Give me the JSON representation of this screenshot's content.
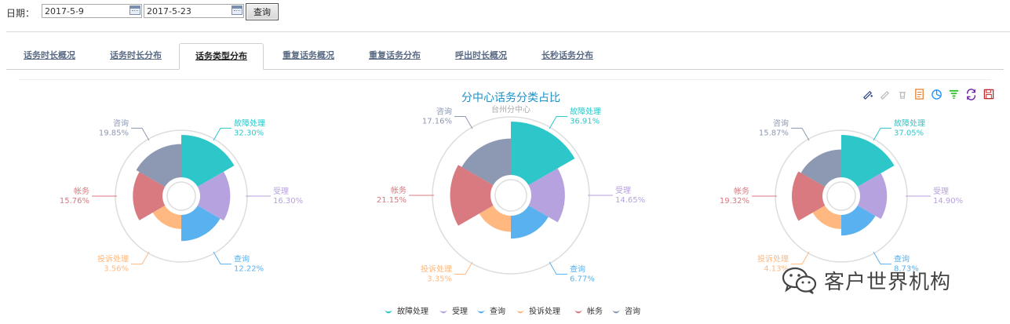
{
  "filter": {
    "date_label": "日期：",
    "start_date": "2017-5-9",
    "end_date": "2017-5-23",
    "query_label": "查询"
  },
  "tabs": [
    {
      "label": "话务时长概况",
      "active": false
    },
    {
      "label": "话务时长分布",
      "active": false
    },
    {
      "label": "话务类型分布",
      "active": true
    },
    {
      "label": "重复话务概况",
      "active": false
    },
    {
      "label": "重复话务分布",
      "active": false
    },
    {
      "label": "呼出时长概况",
      "active": false
    },
    {
      "label": "长秒话务分布",
      "active": false
    }
  ],
  "toolbox": [
    "mark-icon",
    "mark-undo-icon",
    "mark-clear-icon",
    "data-view-icon",
    "pie-switch-icon",
    "funnel-switch-icon",
    "restore-icon",
    "save-image-icon"
  ],
  "colors": {
    "故障处理": "#2ec7c9",
    "受理": "#b6a2de",
    "查询": "#5ab1ef",
    "投诉处理": "#ffb980",
    "帐务": "#d87a80",
    "咨询": "#8d98b3"
  },
  "chart_data": [
    {
      "type": "pie",
      "subtype": "rose",
      "title": "",
      "subtitle": "",
      "categories": [
        "故障处理",
        "受理",
        "查询",
        "投诉处理",
        "帐务",
        "咨询"
      ],
      "values": [
        32.3,
        16.3,
        12.22,
        3.56,
        15.76,
        19.85
      ],
      "labels": [
        "32.30%",
        "16.30%",
        "12.22%",
        "3.56%",
        "15.76%",
        "19.85%"
      ]
    },
    {
      "type": "pie",
      "subtype": "rose",
      "title": "分中心话务分类占比",
      "subtitle": "台州分中心",
      "categories": [
        "故障处理",
        "受理",
        "查询",
        "投诉处理",
        "帐务",
        "咨询"
      ],
      "values": [
        36.91,
        14.65,
        6.77,
        3.35,
        21.15,
        17.16
      ],
      "labels": [
        "36.91%",
        "14.65%",
        "6.77%",
        "3.35%",
        "21.15%",
        "17.16%"
      ]
    },
    {
      "type": "pie",
      "subtype": "rose",
      "title": "",
      "subtitle": "",
      "categories": [
        "故障处理",
        "受理",
        "查询",
        "投诉处理",
        "帐务",
        "咨询"
      ],
      "values": [
        37.05,
        14.9,
        8.73,
        4.13,
        19.32,
        15.87
      ],
      "labels": [
        "37.05%",
        "14.90%",
        "8.73%",
        "4.13%",
        "19.32%",
        "15.87%"
      ]
    }
  ],
  "legend": {
    "position": "bottom-center",
    "items": [
      "故障处理",
      "受理",
      "查询",
      "投诉处理",
      "帐务",
      "咨询"
    ]
  },
  "watermark": {
    "text": "客户世界机构"
  }
}
